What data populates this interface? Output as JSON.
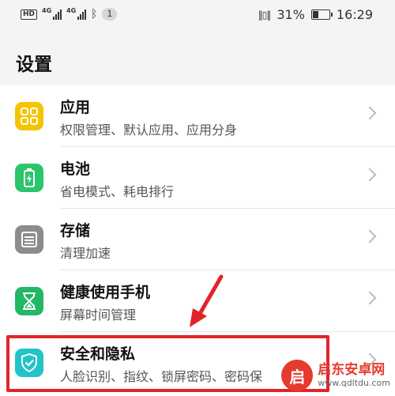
{
  "status_bar": {
    "hd": "HD",
    "sim1_label": "4G",
    "sim2_label": "4G",
    "notification_count": "1",
    "battery_percent": "31%",
    "time": "16:29"
  },
  "header": {
    "title": "设置"
  },
  "settings": {
    "items": [
      {
        "title": "应用",
        "subtitle": "权限管理、默认应用、应用分身",
        "icon": "apps-grid-icon",
        "color": "#f5c400"
      },
      {
        "title": "电池",
        "subtitle": "省电模式、耗电排行",
        "icon": "battery-icon",
        "color": "#2bc56b"
      },
      {
        "title": "存储",
        "subtitle": "清理加速",
        "icon": "storage-icon",
        "color": "#8c8c8c"
      },
      {
        "title": "健康使用手机",
        "subtitle": "屏幕时间管理",
        "icon": "hourglass-icon",
        "color": "#22b865"
      },
      {
        "title": "安全和隐私",
        "subtitle": "人脸识别、指纹、锁屏密码、密码保",
        "icon": "shield-icon",
        "color": "#22c4c8"
      }
    ]
  },
  "watermark": {
    "name": "启东安卓网",
    "url": "www.qdltdu.com",
    "logo_char": "启"
  },
  "annotation": {
    "highlight_color": "#e1242a"
  }
}
